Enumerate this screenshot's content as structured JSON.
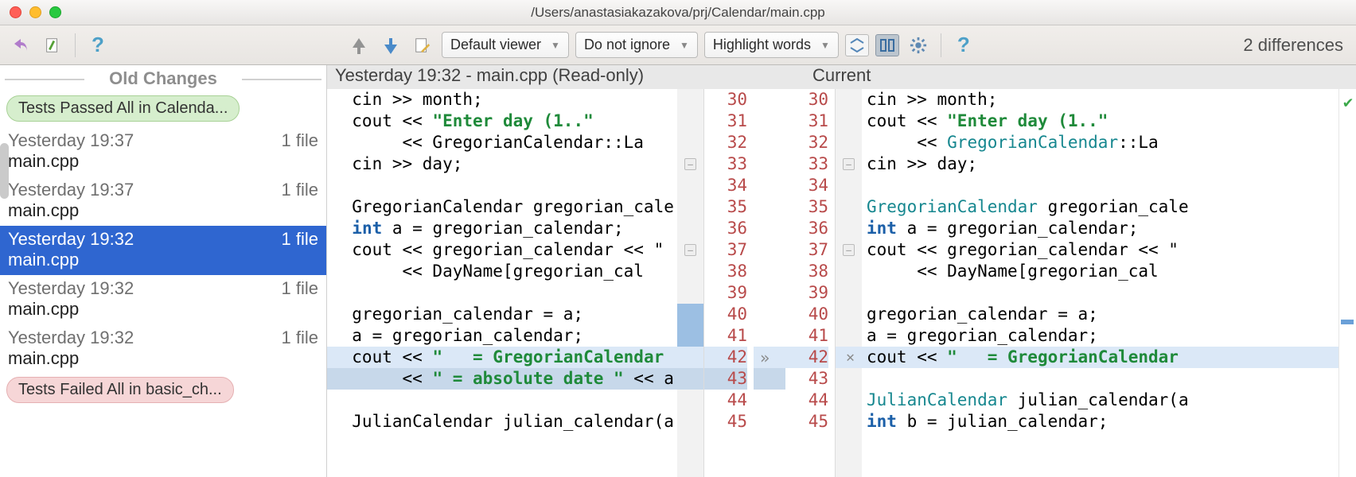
{
  "window": {
    "title": "/Users/anastasiakazakova/prj/Calendar/main.cpp"
  },
  "toolbar": {
    "viewer_dd": "Default viewer",
    "ignore_dd": "Do not ignore",
    "highlight_dd": "Highlight words",
    "diff_count": "2 differences"
  },
  "sidebar": {
    "header": "Old Changes",
    "pill_pass": "Tests Passed All in Calenda...",
    "pill_fail": "Tests Failed All in basic_ch...",
    "items": [
      {
        "time": "Yesterday 19:37",
        "meta": "1 file",
        "file": "main.cpp",
        "selected": false
      },
      {
        "time": "Yesterday 19:37",
        "meta": "1 file",
        "file": "main.cpp",
        "selected": false
      },
      {
        "time": "Yesterday 19:32",
        "meta": "1 file",
        "file": "main.cpp",
        "selected": true
      },
      {
        "time": "Yesterday 19:32",
        "meta": "1 file",
        "file": "main.cpp",
        "selected": false
      },
      {
        "time": "Yesterday 19:32",
        "meta": "1 file",
        "file": "main.cpp",
        "selected": false
      }
    ]
  },
  "panes": {
    "left_title": "Yesterday 19:32 - main.cpp (Read-only)",
    "right_title": "Current"
  },
  "code": {
    "left": [
      {
        "n": 30,
        "tokens": [
          {
            "t": "  cin >> month;",
            "c": ""
          }
        ]
      },
      {
        "n": 31,
        "tokens": [
          {
            "t": "  cout << ",
            "c": ""
          },
          {
            "t": "\"Enter day (1..\"",
            "c": "str"
          }
        ]
      },
      {
        "n": 32,
        "tokens": [
          {
            "t": "       << GregorianCalendar::La",
            "c": ""
          }
        ]
      },
      {
        "n": 33,
        "tokens": [
          {
            "t": "  cin >> day;",
            "c": ""
          }
        ],
        "fold": true
      },
      {
        "n": 34,
        "tokens": [
          {
            "t": "",
            "c": ""
          }
        ]
      },
      {
        "n": 35,
        "tokens": [
          {
            "t": "  GregorianCalendar gregorian_cale",
            "c": ""
          }
        ]
      },
      {
        "n": 36,
        "tokens": [
          {
            "t": "  ",
            "c": ""
          },
          {
            "t": "int",
            "c": "kw"
          },
          {
            "t": " a = gregorian_calendar;",
            "c": ""
          }
        ]
      },
      {
        "n": 37,
        "tokens": [
          {
            "t": "  cout << gregorian_calendar << \"",
            "c": ""
          }
        ],
        "fold": true
      },
      {
        "n": 38,
        "tokens": [
          {
            "t": "       << DayName[gregorian_cal",
            "c": ""
          }
        ]
      },
      {
        "n": 39,
        "tokens": [
          {
            "t": "",
            "c": ""
          }
        ]
      },
      {
        "n": 40,
        "tokens": [
          {
            "t": "  gregorian_calendar = a;",
            "c": ""
          }
        ],
        "mark": "blue"
      },
      {
        "n": 41,
        "tokens": [
          {
            "t": "  a = gregorian_calendar;",
            "c": ""
          }
        ],
        "mark": "blue"
      },
      {
        "n": 42,
        "tokens": [
          {
            "t": "  cout << ",
            "c": ""
          },
          {
            "t": "\"   = GregorianCalendar",
            "c": "str"
          }
        ],
        "hl": "blue",
        "arrow": true
      },
      {
        "n": 43,
        "tokens": [
          {
            "t": "       << ",
            "c": ""
          },
          {
            "t": "\" = absolute date \"",
            "c": "str"
          },
          {
            "t": " << a",
            "c": ""
          }
        ],
        "hl": "blue-strong"
      },
      {
        "n": 44,
        "tokens": [
          {
            "t": "",
            "c": ""
          }
        ]
      },
      {
        "n": 45,
        "tokens": [
          {
            "t": "  JulianCalendar julian_calendar(a",
            "c": ""
          }
        ]
      }
    ],
    "right": [
      {
        "n": 30,
        "tokens": [
          {
            "t": "cin >> month;",
            "c": ""
          }
        ]
      },
      {
        "n": 31,
        "tokens": [
          {
            "t": "cout << ",
            "c": ""
          },
          {
            "t": "\"Enter day (1..\"",
            "c": "str"
          }
        ]
      },
      {
        "n": 32,
        "tokens": [
          {
            "t": "     << ",
            "c": ""
          },
          {
            "t": "GregorianCalendar",
            "c": "type"
          },
          {
            "t": "::La",
            "c": ""
          }
        ]
      },
      {
        "n": 33,
        "tokens": [
          {
            "t": "cin >> day;",
            "c": ""
          }
        ],
        "fold": true
      },
      {
        "n": 34,
        "tokens": [
          {
            "t": "",
            "c": ""
          }
        ]
      },
      {
        "n": 35,
        "tokens": [
          {
            "t": "",
            "c": ""
          },
          {
            "t": "GregorianCalendar",
            "c": "type"
          },
          {
            "t": " gregorian_cale",
            "c": ""
          }
        ]
      },
      {
        "n": 36,
        "tokens": [
          {
            "t": "",
            "c": ""
          },
          {
            "t": "int",
            "c": "kw"
          },
          {
            "t": " a = gregorian_calendar;",
            "c": ""
          }
        ]
      },
      {
        "n": 37,
        "tokens": [
          {
            "t": "cout << gregorian_calendar << \"",
            "c": ""
          }
        ],
        "fold": true
      },
      {
        "n": 38,
        "tokens": [
          {
            "t": "     << DayName[gregorian_cal",
            "c": ""
          }
        ]
      },
      {
        "n": 39,
        "tokens": [
          {
            "t": "",
            "c": ""
          }
        ]
      },
      {
        "n": 40,
        "tokens": [
          {
            "t": "gregorian_calendar = a;",
            "c": ""
          }
        ]
      },
      {
        "n": 41,
        "tokens": [
          {
            "t": "a = gregorian_calendar;",
            "c": ""
          }
        ]
      },
      {
        "n": 42,
        "tokens": [
          {
            "t": "cout << ",
            "c": ""
          },
          {
            "t": "\"   = GregorianCalendar",
            "c": "str"
          }
        ],
        "hl": "blue",
        "x": true
      },
      {
        "n": 43,
        "tokens": [
          {
            "t": "",
            "c": ""
          }
        ]
      },
      {
        "n": 44,
        "tokens": [
          {
            "t": "",
            "c": ""
          },
          {
            "t": "JulianCalendar",
            "c": "type"
          },
          {
            "t": " julian_calendar(a",
            "c": ""
          }
        ]
      },
      {
        "n": 45,
        "tokens": [
          {
            "t": "",
            "c": ""
          },
          {
            "t": "int",
            "c": "kw"
          },
          {
            "t": " b = julian_calendar;",
            "c": ""
          }
        ]
      }
    ]
  }
}
